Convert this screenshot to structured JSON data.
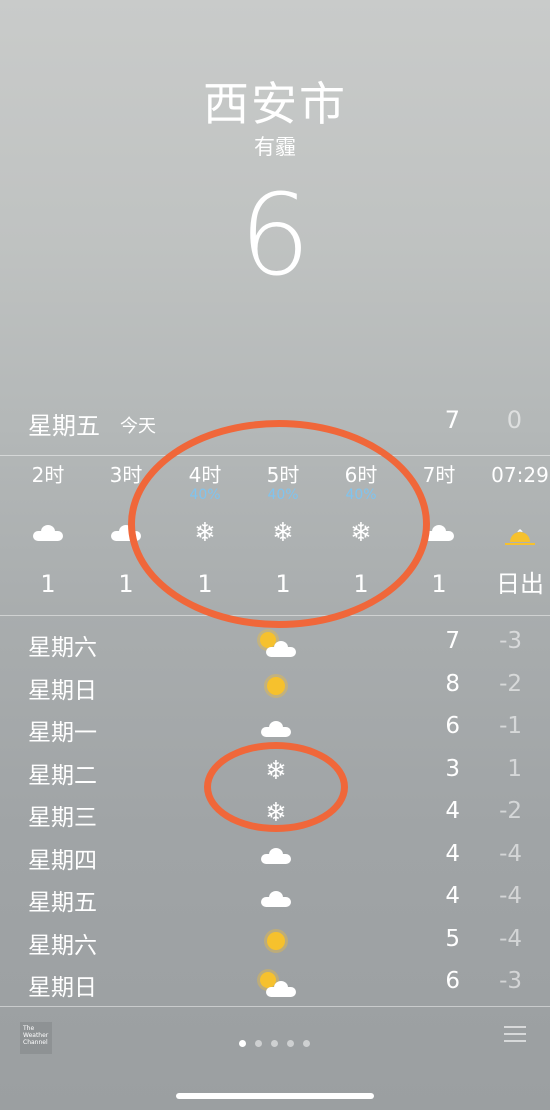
{
  "location": {
    "city": "西安市",
    "condition": "有霾",
    "temperature": "6"
  },
  "today": {
    "day": "星期五",
    "label": "今天",
    "high": "7",
    "low": "0"
  },
  "hourly": [
    {
      "time": "2时",
      "precip": "",
      "icon": "cloud-icon",
      "temp": "1"
    },
    {
      "time": "3时",
      "precip": "",
      "icon": "cloud-icon",
      "temp": "1"
    },
    {
      "time": "4时",
      "precip": "40%",
      "icon": "snowflake-icon",
      "temp": "1"
    },
    {
      "time": "5时",
      "precip": "40%",
      "icon": "snowflake-icon",
      "temp": "1"
    },
    {
      "time": "6时",
      "precip": "40%",
      "icon": "snowflake-icon",
      "temp": "1"
    },
    {
      "time": "7时",
      "precip": "",
      "icon": "cloud-icon",
      "temp": "1"
    },
    {
      "time": "07:29",
      "precip": "",
      "icon": "sunrise-icon",
      "temp": "日出"
    }
  ],
  "daily": [
    {
      "day": "星期六",
      "icon": "partly-sunny-icon",
      "high": "7",
      "low": "-3"
    },
    {
      "day": "星期日",
      "icon": "sun-icon",
      "high": "8",
      "low": "-2"
    },
    {
      "day": "星期一",
      "icon": "cloud-icon",
      "high": "6",
      "low": "-1"
    },
    {
      "day": "星期二",
      "icon": "snowflake-icon",
      "high": "3",
      "low": "1"
    },
    {
      "day": "星期三",
      "icon": "snowflake-icon",
      "high": "4",
      "low": "-2"
    },
    {
      "day": "星期四",
      "icon": "cloud-icon",
      "high": "4",
      "low": "-4"
    },
    {
      "day": "星期五",
      "icon": "cloud-icon",
      "high": "4",
      "low": "-4"
    },
    {
      "day": "星期六",
      "icon": "sun-icon",
      "high": "5",
      "low": "-4"
    },
    {
      "day": "星期日",
      "icon": "partly-sunny-icon",
      "high": "6",
      "low": "-3"
    }
  ],
  "footer": {
    "logo_text": "The Weather Channel",
    "page_count": 5,
    "active_page": 0
  },
  "colors": {
    "annotation": "#f0673a",
    "precip": "#7fc4ef",
    "sun": "#f6c12d"
  }
}
